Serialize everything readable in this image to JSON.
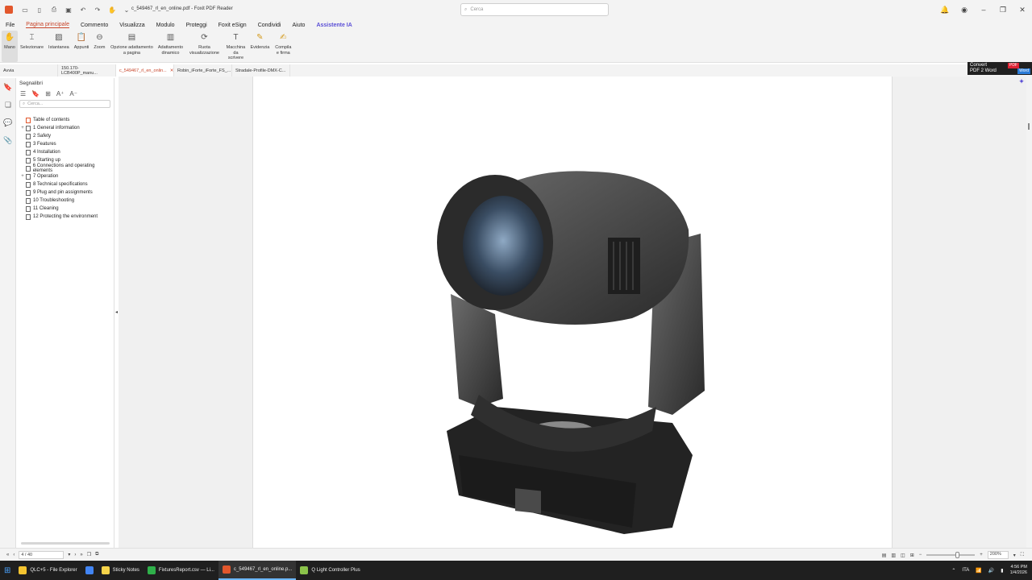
{
  "titlebar": {
    "title": "c_549467_rl_en_online.pdf - Foxit PDF Reader",
    "search_placeholder": "Cerca"
  },
  "menu": [
    "File",
    "Pagina principale",
    "Commento",
    "Visualizza",
    "Modulo",
    "Proteggi",
    "Foxit eSign",
    "Condividi",
    "Aiuto",
    "Assistente IA"
  ],
  "ribbon": [
    {
      "label": "Mano",
      "icon": "hand-icon"
    },
    {
      "label": "Selezionare",
      "icon": "select-text-icon"
    },
    {
      "label": "Istantanea",
      "icon": "snapshot-icon"
    },
    {
      "label": "Appunti",
      "icon": "clipboard-icon"
    },
    {
      "label": "Zoom",
      "icon": "zoom-icon"
    },
    {
      "label": "Opzione adattamento a pagina",
      "icon": "fit-page-icon"
    },
    {
      "label": "Adattamento dinamico",
      "icon": "reflow-icon"
    },
    {
      "label": "Ruota visualizzazione",
      "icon": "rotate-icon"
    },
    {
      "label": "Macchina da scrivere",
      "icon": "typewriter-icon"
    },
    {
      "label": "Evidenzia",
      "icon": "highlight-icon"
    },
    {
      "label": "Compila e firma",
      "icon": "fill-sign-icon"
    }
  ],
  "tabs": [
    {
      "label": "Avvia",
      "active": false
    },
    {
      "label": "150.170-LCB400P_manu...",
      "active": false
    },
    {
      "label": "c_549467_rl_en_onlin...",
      "active": true
    },
    {
      "label": "Robin_iForte_iForte_FS_...",
      "active": false
    },
    {
      "label": "Stradale-Profile-DMX-C...",
      "active": false
    }
  ],
  "convert": {
    "line1": "Convert",
    "line2": "PDF 2 Word",
    "pdf": "PDF",
    "word": "Word"
  },
  "bookmarks": {
    "title": "Segnalibri",
    "search_placeholder": "Cerca...",
    "items": [
      {
        "label": "Table of contents",
        "expandable": false,
        "red": true
      },
      {
        "label": "1 General information",
        "expandable": true
      },
      {
        "label": "2 Safety",
        "expandable": false
      },
      {
        "label": "3 Features",
        "expandable": false
      },
      {
        "label": "4 Installation",
        "expandable": false
      },
      {
        "label": "5 Starting up",
        "expandable": false
      },
      {
        "label": "6 Connections and operating elements",
        "expandable": false
      },
      {
        "label": "7 Operation",
        "expandable": true
      },
      {
        "label": "8 Technical specifications",
        "expandable": false
      },
      {
        "label": "9 Plug and pin assignments",
        "expandable": false
      },
      {
        "label": "10 Troubleshooting",
        "expandable": false
      },
      {
        "label": "11 Cleaning",
        "expandable": false
      },
      {
        "label": "12 Protecting the environment",
        "expandable": false
      }
    ]
  },
  "status": {
    "page": "4 / 40",
    "zoom": "200%",
    "zoom_fraction": 0.63
  },
  "taskbar": {
    "tasks": [
      {
        "label": "QLC+5 - File Explorer",
        "color": "#f4c430"
      },
      {
        "label": "",
        "color": "#4285f4"
      },
      {
        "label": "Sticky Notes",
        "color": "#f7d44a"
      },
      {
        "label": "FixturesReport.csv — Li...",
        "color": "#2fb04a"
      },
      {
        "label": "c_549467_rl_en_online.p...",
        "color": "#e2572c"
      },
      {
        "label": "Q Light Controller Plus",
        "color": "#8bc34a"
      }
    ],
    "lang": "ITA",
    "time": "4:56 PM",
    "date": "1/4/2026"
  }
}
